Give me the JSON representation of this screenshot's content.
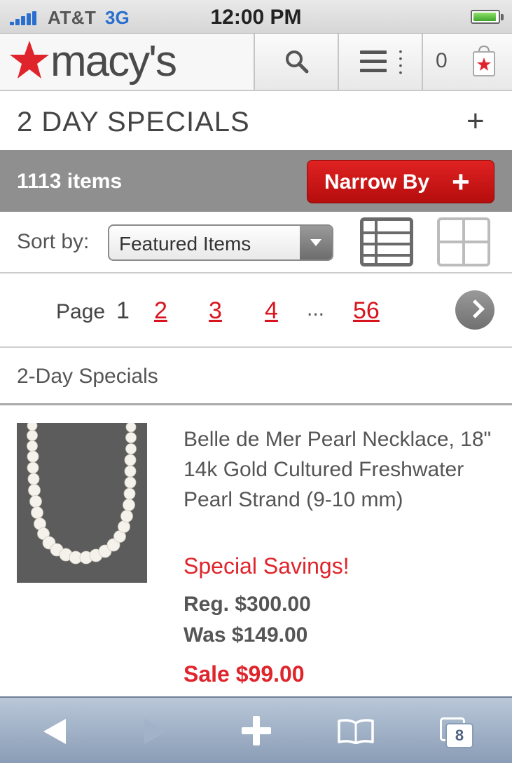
{
  "status_bar": {
    "carrier": "AT&T",
    "network": "3G",
    "time": "12:00 PM",
    "signal_bars": 5,
    "battery_level": 0.85,
    "battery_color": "#3fa62a"
  },
  "header": {
    "logo_text": "macy's",
    "logo_star_color": "#e0242b",
    "search_icon": "search-icon",
    "menu_icon": "menu-icon",
    "bag_count": "0",
    "bag_icon": "shopping-bag-icon"
  },
  "title_row": {
    "title": "2 DAY SPECIALS",
    "expand_label": "+"
  },
  "items_bar": {
    "count": "1113 items",
    "narrow_label": "Narrow By",
    "narrow_plus": "+",
    "narrow_color": "#d01818"
  },
  "sort": {
    "label": "Sort by:",
    "selected": "Featured Items",
    "list_view_icon": "list-view-icon",
    "grid_view_icon": "grid-view-icon"
  },
  "pagination": {
    "label": "Page",
    "current": "1",
    "pages": [
      "2",
      "3",
      "4"
    ],
    "ellipsis": "...",
    "last": "56",
    "next_icon": "next-arrow-icon",
    "link_color": "#d8151f"
  },
  "section": {
    "title": "2-Day Specials"
  },
  "product": {
    "name": "Belle de Mer Pearl Necklace, 18\" 14k Gold Cultured Freshwater Pearl Strand (9-10 mm)",
    "promo": "Special Savings!",
    "reg_price": "Reg. $300.00",
    "was_price": "Was $149.00",
    "sale_price": "Sale $99.00",
    "accent_color": "#e0242b"
  },
  "toolbar": {
    "back_icon": "back-arrow-icon",
    "forward_icon": "forward-arrow-icon",
    "add_icon": "add-bookmark-icon",
    "bookmarks_icon": "bookmarks-book-icon",
    "tabs_icon": "tabs-icon",
    "tabs_count": "8"
  }
}
